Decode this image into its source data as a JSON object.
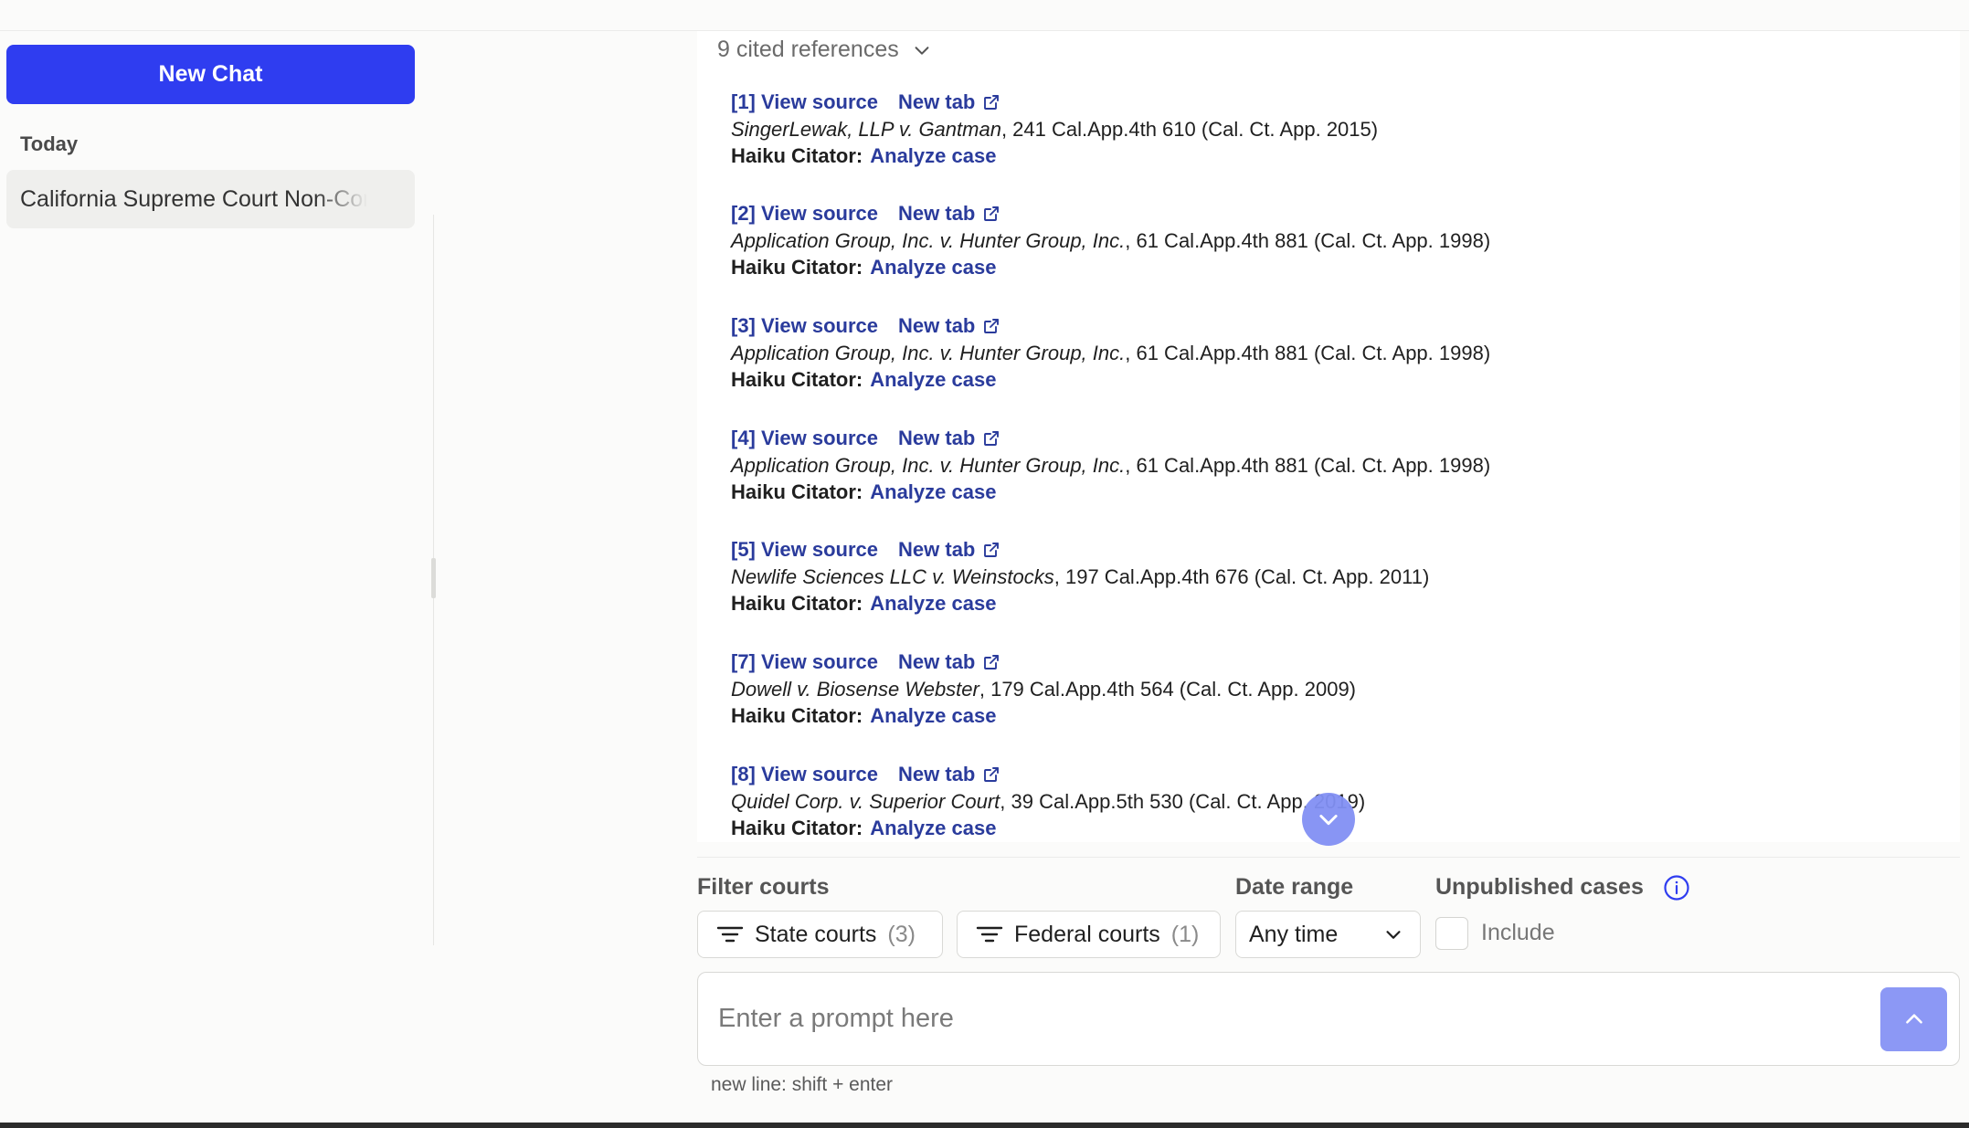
{
  "sidebar": {
    "new_chat_label": "New Chat",
    "section_label": "Today",
    "history": [
      {
        "title": "California Supreme Court Non-Compete"
      }
    ]
  },
  "references": {
    "header": "9 cited references",
    "view_source_label": "View source",
    "new_tab_label": "New tab",
    "citator_label": "Haiku Citator:",
    "analyze_label": "Analyze case",
    "items": [
      {
        "num": "[1]",
        "case": "SingerLewak, LLP v. Gantman",
        "cite": ", 241 Cal.App.4th 610 (Cal. Ct. App. 2015)"
      },
      {
        "num": "[2]",
        "case": "Application Group, Inc. v. Hunter Group, Inc.",
        "cite": ", 61 Cal.App.4th 881 (Cal. Ct. App. 1998)"
      },
      {
        "num": "[3]",
        "case": "Application Group, Inc. v. Hunter Group, Inc.",
        "cite": ", 61 Cal.App.4th 881 (Cal. Ct. App. 1998)"
      },
      {
        "num": "[4]",
        "case": "Application Group, Inc. v. Hunter Group, Inc.",
        "cite": ", 61 Cal.App.4th 881 (Cal. Ct. App. 1998)"
      },
      {
        "num": "[5]",
        "case": "Newlife Sciences LLC v. Weinstocks",
        "cite": ", 197 Cal.App.4th 676 (Cal. Ct. App. 2011)"
      },
      {
        "num": "[7]",
        "case": "Dowell v. Biosense Webster",
        "cite": ", 179 Cal.App.4th 564 (Cal. Ct. App. 2009)"
      },
      {
        "num": "[8]",
        "case": "Quidel Corp. v. Superior Court",
        "cite": ", 39 Cal.App.5th 530 (Cal. Ct. App. 2019)"
      }
    ]
  },
  "filters": {
    "courts_label": "Filter courts",
    "state_label": "State courts",
    "state_count": "(3)",
    "federal_label": "Federal courts",
    "federal_count": "(1)",
    "date_label": "Date range",
    "date_value": "Any time",
    "unpublished_label": "Unpublished cases",
    "include_label": "Include"
  },
  "prompt": {
    "placeholder": "Enter a prompt here",
    "hint": "new line: shift + enter"
  },
  "colors": {
    "accent": "#2f3df0",
    "link": "#2a3b9c",
    "send_button": "#8c98f5"
  }
}
